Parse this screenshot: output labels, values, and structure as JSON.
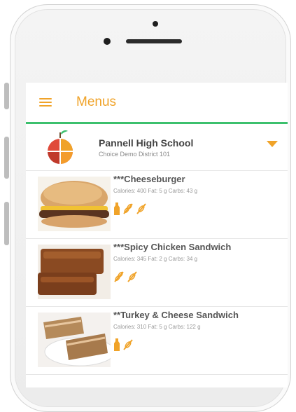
{
  "app": {
    "title": "Menus"
  },
  "school": {
    "name": "Pannell High School",
    "district": "Choice Demo District 101"
  },
  "menu_items": [
    {
      "name": "***Cheeseburger",
      "nutrition": "Calories: 400  Fat: 5 g  Carbs: 43 g",
      "allergen_icons": [
        "milk-icon",
        "wheat-icon",
        "wheat-icon"
      ]
    },
    {
      "name": "***Spicy Chicken Sandwich",
      "nutrition": "Calories: 345  Fat: 2 g  Carbs: 34 g",
      "allergen_icons": [
        "wheat-icon",
        "wheat-icon"
      ]
    },
    {
      "name": "**Turkey & Cheese Sandwich",
      "nutrition": "Calories: 310  Fat: 5 g  Carbs: 122 g",
      "allergen_icons": [
        "milk-icon",
        "wheat-icon"
      ]
    }
  ],
  "colors": {
    "accent": "#f0a329",
    "divider": "#3cc06d"
  }
}
